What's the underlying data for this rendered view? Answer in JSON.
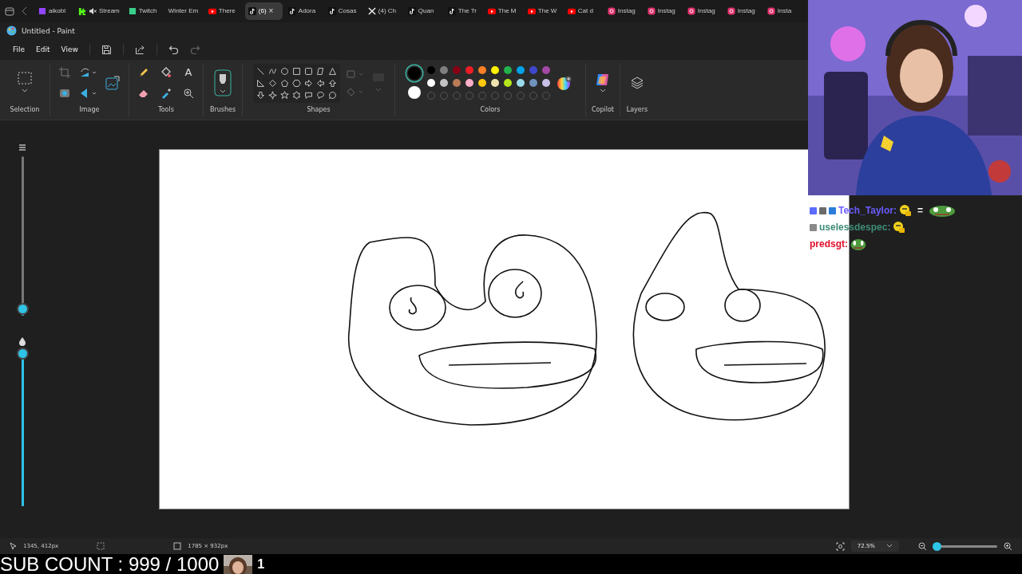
{
  "browser_tabs": [
    {
      "kind": "twitch",
      "label": "aikobl",
      "selected": false
    },
    {
      "kind": "kick",
      "label": "Stream",
      "selected": false,
      "muted": true
    },
    {
      "kind": "tt",
      "label": "Twitch",
      "selected": false
    },
    {
      "kind": "plain",
      "label": "Winter Em",
      "selected": false
    },
    {
      "kind": "youtube",
      "label": "There",
      "selected": false
    },
    {
      "kind": "tiktok",
      "label": "(6)",
      "selected": true,
      "close": "×"
    },
    {
      "kind": "tiktok",
      "label": "Adora",
      "selected": false
    },
    {
      "kind": "tiktok",
      "label": "Cosas",
      "selected": false
    },
    {
      "kind": "x",
      "label": "(4) Ch",
      "selected": false
    },
    {
      "kind": "tiktok",
      "label": "Quan",
      "selected": false
    },
    {
      "kind": "tiktok",
      "label": "The Tr",
      "selected": false
    },
    {
      "kind": "youtube",
      "label": "The M",
      "selected": false
    },
    {
      "kind": "youtube",
      "label": "The W",
      "selected": false
    },
    {
      "kind": "youtube",
      "label": "Cat d",
      "selected": false
    },
    {
      "kind": "instagram",
      "label": "Instag",
      "selected": false
    },
    {
      "kind": "instagram",
      "label": "Instag",
      "selected": false
    },
    {
      "kind": "instagram",
      "label": "Instag",
      "selected": false
    },
    {
      "kind": "instagram",
      "label": "Instag",
      "selected": false
    },
    {
      "kind": "instagram",
      "label": "Insta",
      "selected": false
    }
  ],
  "window": {
    "title": "Untitled - Paint"
  },
  "menu": [
    "File",
    "Edit",
    "View"
  ],
  "ribbon": {
    "groups": [
      "Selection",
      "Image",
      "Tools",
      "Brushes",
      "Shapes",
      "Colors",
      "Copilot",
      "Layers"
    ],
    "text_tool": "A",
    "primary_color": {
      "color": "#000000",
      "selected": true
    },
    "secondary_color": {
      "color": "#ffffff",
      "selected": false
    },
    "palette": [
      {
        "color": "#000000"
      },
      {
        "color": "#7f7f7f"
      },
      {
        "color": "#880015"
      },
      {
        "color": "#ed1c24"
      },
      {
        "color": "#ff7f27"
      },
      {
        "color": "#fff200"
      },
      {
        "color": "#22b14c"
      },
      {
        "color": "#00a2e8"
      },
      {
        "color": "#3f48cc"
      },
      {
        "color": "#a349a4"
      },
      {
        "color": "#ffffff"
      },
      {
        "color": "#c3c3c3"
      },
      {
        "color": "#b97a57"
      },
      {
        "color": "#ffaec9"
      },
      {
        "color": "#ffc90e"
      },
      {
        "color": "#efe4b0"
      },
      {
        "color": "#b5e61d"
      },
      {
        "color": "#99d9ea"
      },
      {
        "color": "#7092be"
      },
      {
        "color": "#c8bfe7"
      }
    ]
  },
  "side_sliders": [
    {
      "kind": "size",
      "level": 0.04
    },
    {
      "kind": "opacity",
      "level": 0.98
    }
  ],
  "chat": [
    {
      "user": "Tech_Taylor:",
      "color": "#6a5cff",
      "badges": [
        {
          "color": "#5b6cff"
        },
        {
          "color": "#6b6b6b"
        },
        {
          "color": "#2b7cd8"
        }
      ],
      "parts": [
        {
          "kind": "face"
        },
        {
          "kind": "text",
          "text": "="
        },
        {
          "kind": "frog"
        }
      ]
    },
    {
      "user": "uselessdespec:",
      "color": "#3d8c78",
      "badges": [
        {
          "color": "#8a8a8a"
        }
      ],
      "parts": [
        {
          "kind": "face"
        }
      ]
    },
    {
      "user": "predsgt:",
      "color": "#e0102a",
      "parts": [
        {
          "kind": "frog"
        }
      ]
    }
  ],
  "status_bar": {
    "cursor": "1345, 412px",
    "canvas_size": "1785 × 932px",
    "zoom": "72.5%",
    "zoom_level": {
      "level": 0.05
    }
  },
  "overlay": {
    "sub_count": "SUB COUNT : 999 / 1000",
    "badge_number": "1"
  }
}
